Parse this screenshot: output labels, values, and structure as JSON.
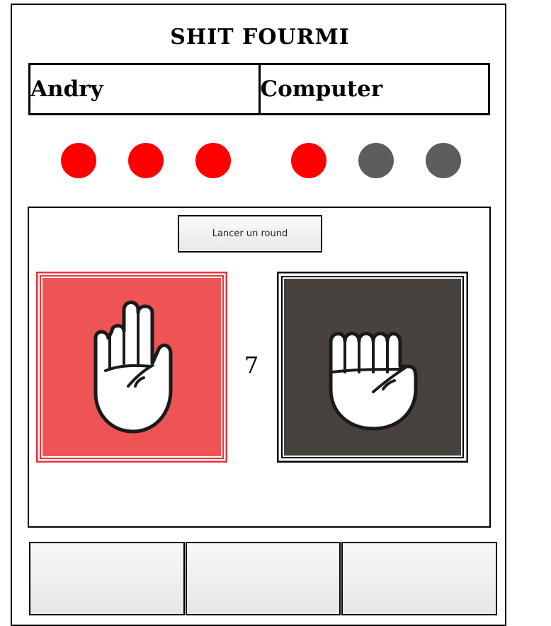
{
  "title": "SHIT FOURMI",
  "players": [
    {
      "name": "Andry"
    },
    {
      "name": "Computer"
    }
  ],
  "lives": {
    "player": [
      true,
      true,
      true
    ],
    "computer": [
      true,
      false,
      false
    ],
    "active_color": "#ff0000",
    "lost_color": "#5d5d5d"
  },
  "round_button": {
    "label": "Lancer un round"
  },
  "player_hand": {
    "icon": "open-palm-hand-icon",
    "bg_color": "#ee5456",
    "border_color": "#e8343a"
  },
  "computer_hand": {
    "icon": "closed-fist-hand-icon",
    "bg_color": "#47423e",
    "border_color": "#000000"
  },
  "round_counter": "7",
  "choices": [
    "",
    "",
    ""
  ]
}
